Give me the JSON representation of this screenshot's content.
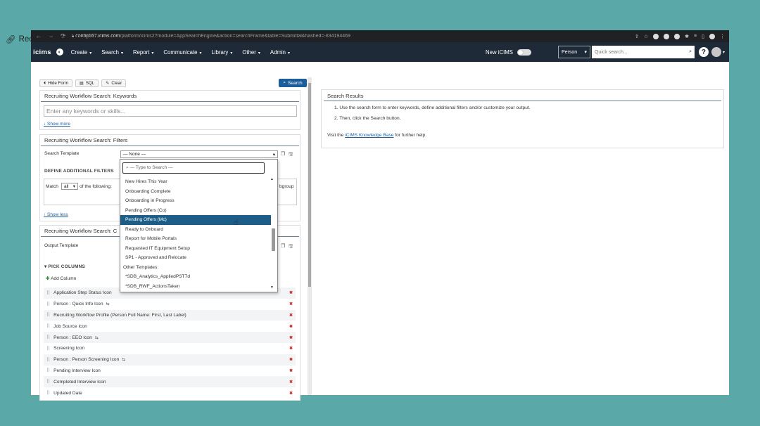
{
  "browser": {
    "url_host": "config167.icims.com",
    "url_path": "/platform/icims2?module=AppSearchEngine&action=searchFrame&table=Submittal&hashed=-834194469"
  },
  "appbar": {
    "logo": "icims",
    "menu": [
      "Create",
      "Search",
      "Report",
      "Communicate",
      "Library",
      "Other",
      "Admin"
    ],
    "new_icims_label": "New iCIMS",
    "person_select": "Person",
    "quick_search_placeholder": "Quick search..."
  },
  "page": {
    "title": "Recruiting Workflow Search",
    "hide_form": "Hide Form",
    "sql": "SQL",
    "clear": "Clear",
    "search": "Search"
  },
  "keywords": {
    "header": "Recruiting Workflow Search: Keywords",
    "placeholder": "Enter any keywords or skills...",
    "show_more": "↓ Show more"
  },
  "filters": {
    "header": "Recruiting Workflow Search: Filters",
    "search_template_label": "Search Template",
    "search_template_value": "— None —",
    "define_label": "DEFINE ADDITIONAL FILTERS",
    "match_prefix": "Match",
    "match_value": "all",
    "match_suffix": "of the following:",
    "subgroup_label": "bgroup",
    "show_less": "↑ Show less"
  },
  "output": {
    "header": "Recruiting Workflow Search: C",
    "output_template_label": "Output Template",
    "pick_columns": "PICK COLUMNS",
    "add_column": "Add Column",
    "columns": [
      {
        "label": "Application Step Status Icon",
        "sub": ""
      },
      {
        "label": "Person : Quick Info Icon",
        "sub": "⇆"
      },
      {
        "label": "Recruiting Workflow Profile (Person Full Name: First, Last Label)",
        "sub": ""
      },
      {
        "label": "Job Source Icon",
        "sub": ""
      },
      {
        "label": "Person : EEO Icon",
        "sub": "⇆"
      },
      {
        "label": "Screening Icon",
        "sub": ""
      },
      {
        "label": "Person : Person Screening Icon",
        "sub": "⇆"
      },
      {
        "label": "Pending Interview Icon",
        "sub": ""
      },
      {
        "label": "Completed Interview Icon",
        "sub": ""
      },
      {
        "label": "Updated Date",
        "sub": ""
      }
    ]
  },
  "dropdown": {
    "search_placeholder": "— Type to Search —",
    "items": [
      {
        "label": "New Hires This Year",
        "selected": false,
        "group": false
      },
      {
        "label": "Onboarding Complete",
        "selected": false,
        "group": false
      },
      {
        "label": "Onboarding in Progress",
        "selected": false,
        "group": false
      },
      {
        "label": "Pending Offers (Co)",
        "selected": false,
        "group": false
      },
      {
        "label": "Pending Offers (Mc)",
        "selected": true,
        "group": false
      },
      {
        "label": "Ready to Onboard",
        "selected": false,
        "group": false
      },
      {
        "label": "Report for Mobile Portals",
        "selected": false,
        "group": false
      },
      {
        "label": "Requested IT Equipment Setup",
        "selected": false,
        "group": false
      },
      {
        "label": "SP1 - Approved and Relocate",
        "selected": false,
        "group": false
      },
      {
        "label": "Other Templates:",
        "selected": false,
        "group": true
      },
      {
        "label": "*SDB_Analytics_AppliedPST7d",
        "selected": false,
        "group": false
      },
      {
        "label": "*SDB_RWF_ActionsTaken",
        "selected": false,
        "group": false
      }
    ]
  },
  "results": {
    "header": "Search Results",
    "step1": "1. Use the search form to enter keywords, define additional filters and/or customize your output.",
    "step2": "2. Then, click the Search button.",
    "visit_prefix": "Visit the",
    "kb_link": "iCIMS Knowledge Base",
    "visit_suffix": "for further help."
  }
}
